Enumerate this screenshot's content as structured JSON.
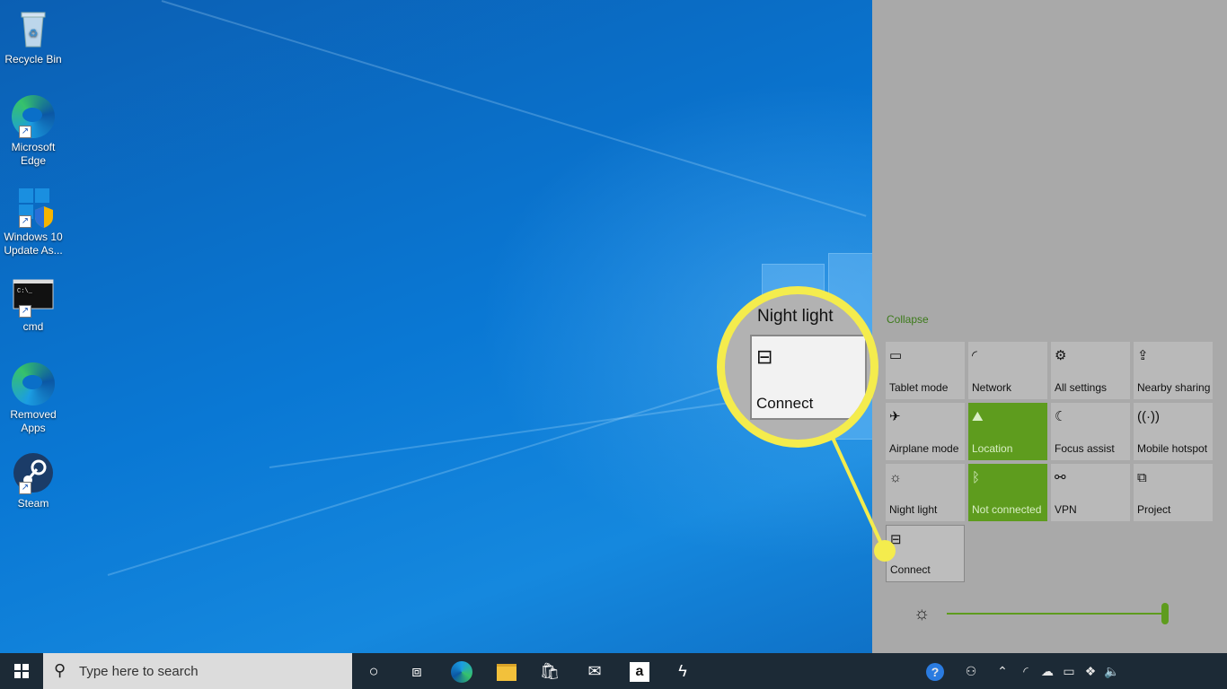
{
  "desktop": {
    "icons": [
      {
        "label": "Recycle Bin",
        "icon": "recycle-bin-icon"
      },
      {
        "label": "Microsoft Edge",
        "icon": "edge-icon"
      },
      {
        "label": "Windows 10 Update As...",
        "icon": "update-assistant-icon"
      },
      {
        "label": "cmd",
        "icon": "cmd-icon"
      },
      {
        "label": "Removed Apps",
        "icon": "edge-icon"
      },
      {
        "label": "Steam",
        "icon": "steam-icon"
      }
    ]
  },
  "action_center": {
    "collapse_label": "Collapse",
    "tiles": [
      {
        "label": "Tablet mode",
        "icon": "tablet-mode-icon",
        "active": false
      },
      {
        "label": "Network",
        "icon": "network-icon",
        "active": false
      },
      {
        "label": "All settings",
        "icon": "gear-icon",
        "active": false
      },
      {
        "label": "Nearby sharing",
        "icon": "nearby-sharing-icon",
        "active": false
      },
      {
        "label": "Airplane mode",
        "icon": "airplane-icon",
        "active": false
      },
      {
        "label": "Location",
        "icon": "location-icon",
        "active": true
      },
      {
        "label": "Focus assist",
        "icon": "moon-icon",
        "active": false
      },
      {
        "label": "Mobile hotspot",
        "icon": "hotspot-icon",
        "active": false
      },
      {
        "label": "Night light",
        "icon": "night-light-icon",
        "active": false
      },
      {
        "label": "Not connected",
        "icon": "bluetooth-icon",
        "active": true
      },
      {
        "label": "VPN",
        "icon": "vpn-icon",
        "active": false
      },
      {
        "label": "Project",
        "icon": "project-icon",
        "active": false
      },
      {
        "label": "Connect",
        "icon": "connect-icon",
        "active": false
      }
    ],
    "brightness": {
      "icon": "brightness-icon",
      "level": 1.0
    }
  },
  "callout": {
    "title": "Night light",
    "tile_label": "Connect",
    "color": "#f4ec4d"
  },
  "taskbar": {
    "search_placeholder": "Type here to search",
    "apps": [
      "cortana-icon",
      "task-view-icon",
      "edge-icon",
      "file-explorer-icon",
      "store-icon",
      "mail-icon",
      "amazon-icon",
      "bolt-app-icon"
    ],
    "tray": [
      "help-icon",
      "people-icon",
      "chevron-up-icon",
      "wifi-icon",
      "onedrive-icon",
      "battery-icon",
      "dropbox-icon",
      "volume-icon"
    ]
  },
  "colors": {
    "accent": "#5e9c1e",
    "action_center_bg": "#a9a9a9",
    "taskbar": "#1c2a36"
  }
}
